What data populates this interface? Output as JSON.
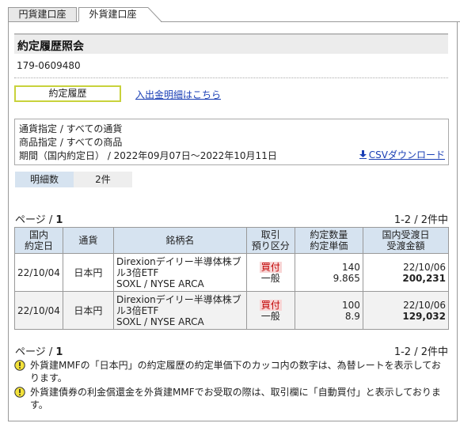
{
  "tabs": [
    {
      "label": "円貨建口座"
    },
    {
      "label": "外貨建口座"
    }
  ],
  "page_title": "約定履歴照会",
  "account_number": "179-0609480",
  "history_button": "約定履歴",
  "deposit_link": "入出金明細はこちら",
  "filters": {
    "currency": "通貨指定 / すべての通貨",
    "product": "商品指定 / すべての商品",
    "period": "期間（国内約定日） / 2022年09月07日〜2022年10月11日"
  },
  "csv_link": "CSVダウンロード",
  "count": {
    "label": "明細数",
    "value": "2件"
  },
  "pager": {
    "prefix": "ページ / ",
    "page": "1",
    "range": "1-2 / 2件中"
  },
  "table": {
    "headers": {
      "date": [
        "国内",
        "約定日"
      ],
      "currency": "通貨",
      "name": "銘柄名",
      "trade": [
        "取引",
        "預り区分"
      ],
      "qty": [
        "約定数量",
        "約定単価"
      ],
      "settle": [
        "国内受渡日",
        "受渡金額"
      ]
    },
    "rows": [
      {
        "date": "22/10/04",
        "currency": "日本円",
        "name": [
          "Direxionデイリー半導体株ブ",
          "ル3倍ETF",
          "SOXL / NYSE ARCA"
        ],
        "trade": "買付",
        "custody": "一般",
        "qty": "140",
        "price": "9.865",
        "settle_date": "22/10/06",
        "amount": "200,231"
      },
      {
        "date": "22/10/04",
        "currency": "日本円",
        "name": [
          "Direxionデイリー半導体株ブ",
          "ル3倍ETF",
          "SOXL / NYSE ARCA"
        ],
        "trade": "買付",
        "custody": "一般",
        "qty": "100",
        "price": "8.9",
        "settle_date": "22/10/06",
        "amount": "129,032"
      }
    ]
  },
  "notes": [
    "外貨建MMFの「日本円」の約定履歴の約定単価下のカッコ内の数字は、為替レートを表示しております。",
    "外貨建債券の利金償還金を外貨建MMFでお受取の際は、取引欄に「自動買付」と表示しております。"
  ],
  "colors": {
    "header_bg": "#d6e3f0",
    "link": "#1a3fb5",
    "buy_bg": "#f8d6d6",
    "buy_text": "#c00000",
    "highlight_border": "#c8d23c"
  }
}
